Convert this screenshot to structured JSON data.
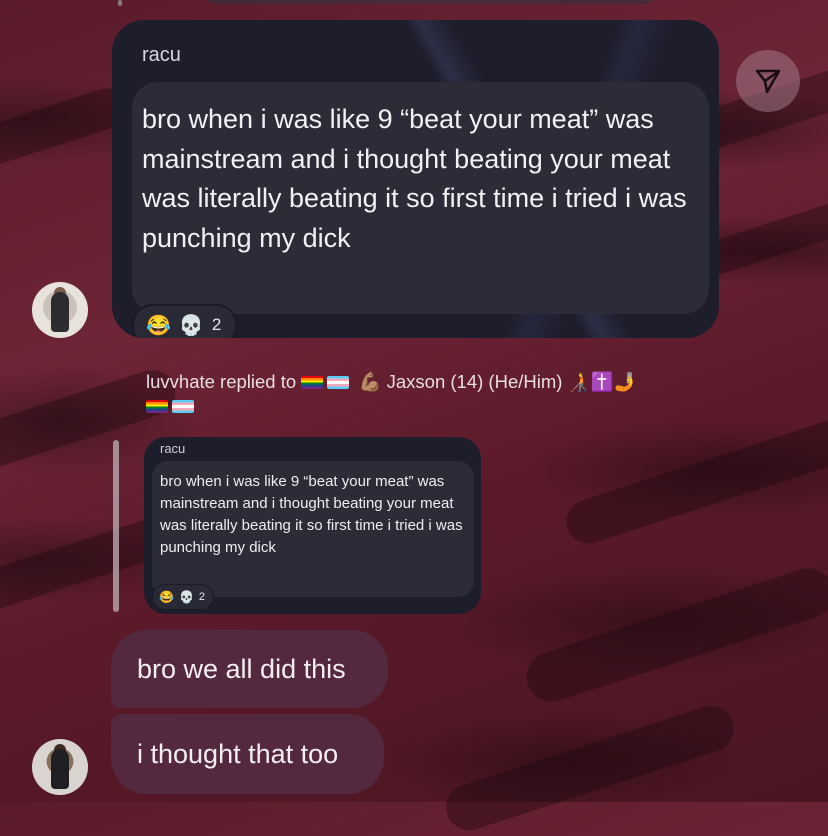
{
  "shared_post": {
    "sender": "racu",
    "text": "bro when i was like 9 “beat your meat” was mainstream and i thought beating your meat was literally beating it so first time i tried i was punching my dick",
    "reactions": {
      "emojis": [
        "😂",
        "💀"
      ],
      "count": "2"
    }
  },
  "reply_header": {
    "actor": "luvvhate",
    "action": "replied to",
    "target_name": "Jaxson (14) (He/Him)",
    "emoji_after": "🧑‍🦯✝️🤳"
  },
  "quoted_post": {
    "sender": "racu",
    "text": "bro when i was like 9 “beat your meat” was mainstream and i thought beating your meat was literally beating it so first time i tried i was punching my dick",
    "reactions": {
      "emojis": [
        "😂",
        "💀"
      ],
      "count": "2"
    }
  },
  "messages": [
    {
      "text": "bro we all did this"
    },
    {
      "text": "i thought that too"
    }
  ],
  "icons": {
    "share": "send-icon"
  },
  "colors": {
    "background": "#5e1d2d",
    "message_bubble": "#54293f",
    "screenshot_bg": "#1e1d2c",
    "share_button": "#a07887"
  }
}
